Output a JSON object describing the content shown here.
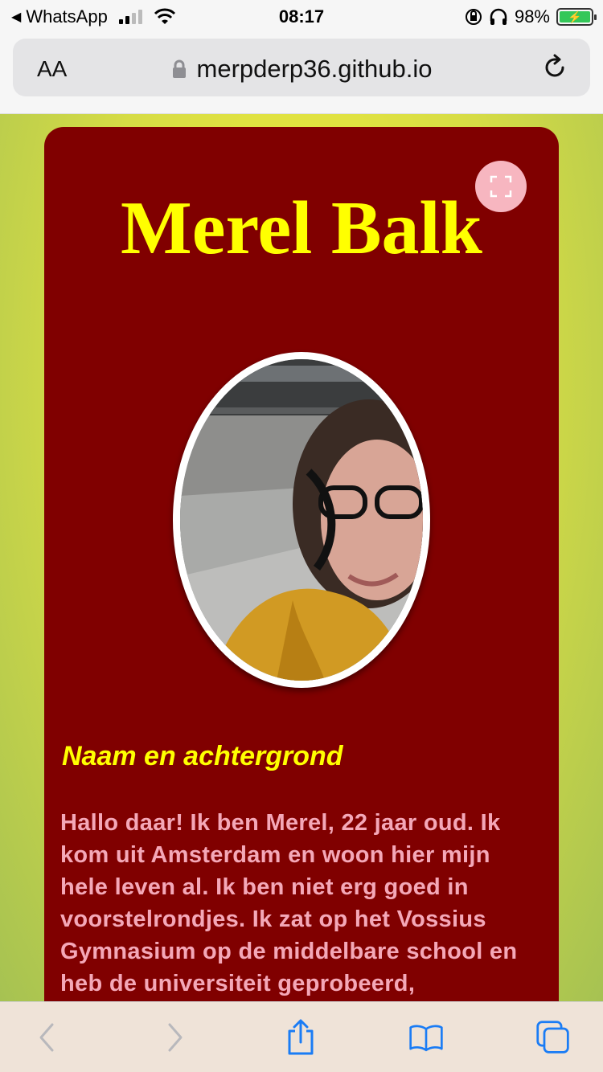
{
  "status_bar": {
    "back_app": "WhatsApp",
    "time": "08:17",
    "battery_percent": "98%"
  },
  "url_bar": {
    "text_size_label": "AA",
    "domain": "merpderp36.github.io"
  },
  "page": {
    "title": "Merel Balk",
    "section_heading": "Naam en achtergrond",
    "bio_text": "Hallo daar! Ik ben Merel, 22 jaar oud. Ik kom uit Amsterdam en woon hier mijn hele leven al. Ik ben niet erg goed in voorstelrondjes. Ik zat op het Vossius Gymnasium op de middelbare school en heb de universiteit geprobeerd,"
  },
  "toolbar": {
    "items": [
      "back-icon",
      "forward-icon",
      "share-icon",
      "bookmarks-icon",
      "tabs-icon"
    ]
  },
  "colors": {
    "card_bg": "#800000",
    "title": "#ffff00",
    "bio_text": "#f4a8b8",
    "page_gradient_center": "#f0ec3a",
    "page_gradient_edge": "#a6c252",
    "ios_blue": "#1a7cf5"
  }
}
